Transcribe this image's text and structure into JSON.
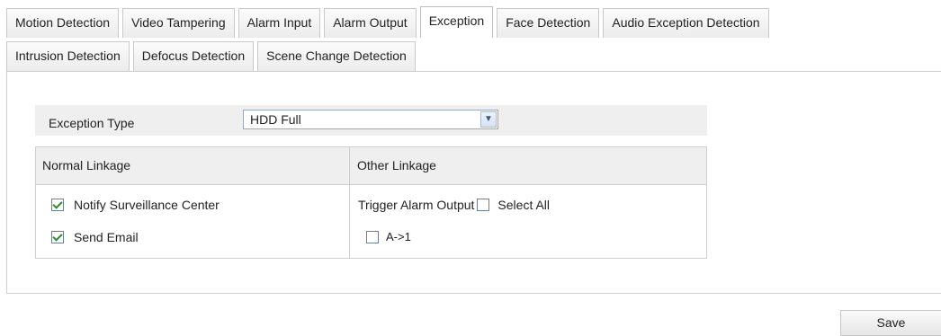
{
  "tabs": {
    "row1": [
      {
        "label": "Motion Detection",
        "active": false
      },
      {
        "label": "Video Tampering",
        "active": false
      },
      {
        "label": "Alarm Input",
        "active": false
      },
      {
        "label": "Alarm Output",
        "active": false
      },
      {
        "label": "Exception",
        "active": true
      },
      {
        "label": "Face Detection",
        "active": false
      },
      {
        "label": "Audio Exception Detection",
        "active": false
      }
    ],
    "row2": [
      {
        "label": "Intrusion Detection",
        "active": false
      },
      {
        "label": "Defocus Detection",
        "active": false
      },
      {
        "label": "Scene Change Detection",
        "active": false
      }
    ]
  },
  "exception": {
    "type_label": "Exception Type",
    "type_value": "HDD Full",
    "dropdown_icon": "chevron-down-icon"
  },
  "linkage": {
    "normal_header": "Normal Linkage",
    "other_header": "Other Linkage",
    "notify_center_label": "Notify Surveillance Center",
    "notify_center_checked": true,
    "send_email_label": "Send Email",
    "send_email_checked": true,
    "trigger_alarm_label": "Trigger Alarm Output",
    "select_all_label": "Select All",
    "select_all_checked": false,
    "output_label": "A->1",
    "output_checked": false
  },
  "actions": {
    "save_label": "Save"
  },
  "colors": {
    "check_mark": "#2e8b2e",
    "header_bg": "#efefef",
    "border": "#cfcfcf"
  }
}
